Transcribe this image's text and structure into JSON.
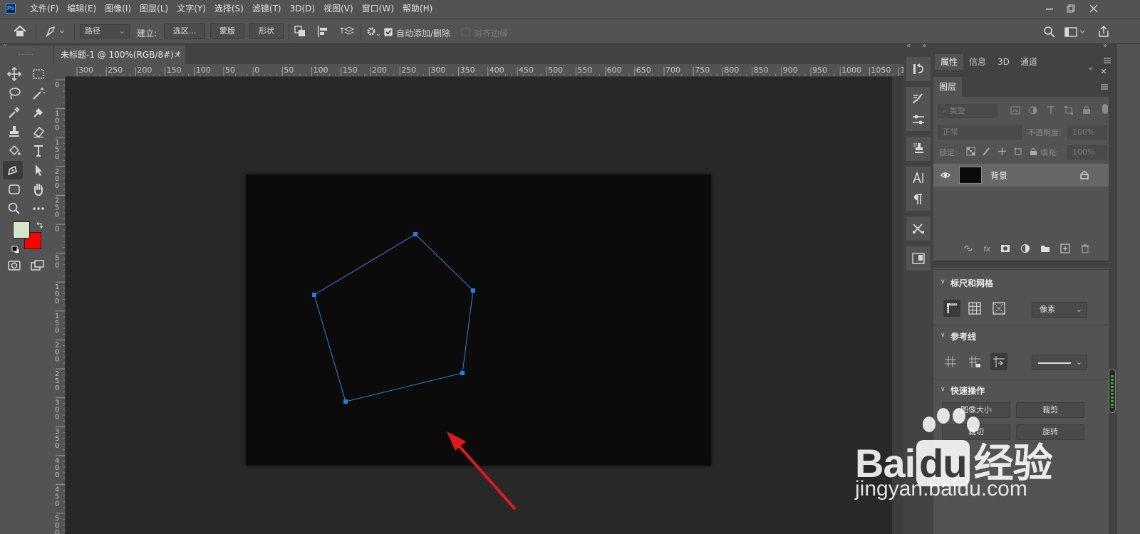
{
  "app": {
    "logo": "Ps",
    "menu": [
      "文件(F)",
      "编辑(E)",
      "图像(I)",
      "图层(L)",
      "文字(Y)",
      "选择(S)",
      "滤镜(T)",
      "3D(D)",
      "视图(V)",
      "窗口(W)",
      "帮助(H)"
    ]
  },
  "options": {
    "mode_value": "路径",
    "make_label": "建立:",
    "selection_button": "选区...",
    "mask_button": "蒙版",
    "shape_button": "形状",
    "auto_add_delete_label": "自动添加/删除",
    "auto_add_delete_checked": true,
    "align_edges_label": "对齐边缘",
    "align_edges_checked": false
  },
  "document": {
    "tab_title": "未标题-1 @ 100%(RGB/8#) *",
    "close_glyph": "×"
  },
  "ruler": {
    "top_ticks": [
      "300",
      "250",
      "200",
      "150",
      "100",
      "50",
      "0",
      "50",
      "100",
      "150",
      "200",
      "250",
      "300",
      "350",
      "400",
      "450",
      "500",
      "550",
      "600",
      "650",
      "700",
      "750",
      "800",
      "850",
      "900",
      "950",
      "1000",
      "1050",
      "1"
    ],
    "left_ticks": [
      "0",
      "1 0 0",
      "1 5 0",
      "2 0 0",
      "2 5 0",
      "0",
      "5 0",
      "1 0 0",
      "1 5 0",
      "2 0 0",
      "2 5 0",
      "3 0 0",
      "3 5 0",
      "4 0 0",
      "4 5 0",
      "5 0 0"
    ]
  },
  "colors": {
    "foreground": "#d5e6c6",
    "background": "#ff0000",
    "path_color": "#3b7fd1",
    "anchor_color": "#2a7be0",
    "arrow_color": "#e01a1a"
  },
  "panels": {
    "tabs": [
      "属性",
      "信息",
      "3D",
      "通道"
    ],
    "active_tab": "属性",
    "layers": {
      "title": "图层",
      "filter_label": "类型",
      "blend_mode": "正常",
      "opacity_label": "不透明度:",
      "opacity_value": "100%",
      "lock_label": "锁定:",
      "fill_label": "填充:",
      "fill_value": "100%",
      "layer_name": "背景"
    },
    "rulers_grid": {
      "title": "标尺和网格",
      "unit": "像素"
    },
    "guides": {
      "title": "参考线"
    },
    "quick_actions": {
      "title": "快速操作",
      "buttons": [
        "图像大小",
        "裁剪",
        "裁切",
        "旋转"
      ]
    }
  },
  "watermark": {
    "brand_a": "Bai",
    "brand_du": "du",
    "brand_cn": "经验",
    "url": "jingyan.baidu.com"
  }
}
